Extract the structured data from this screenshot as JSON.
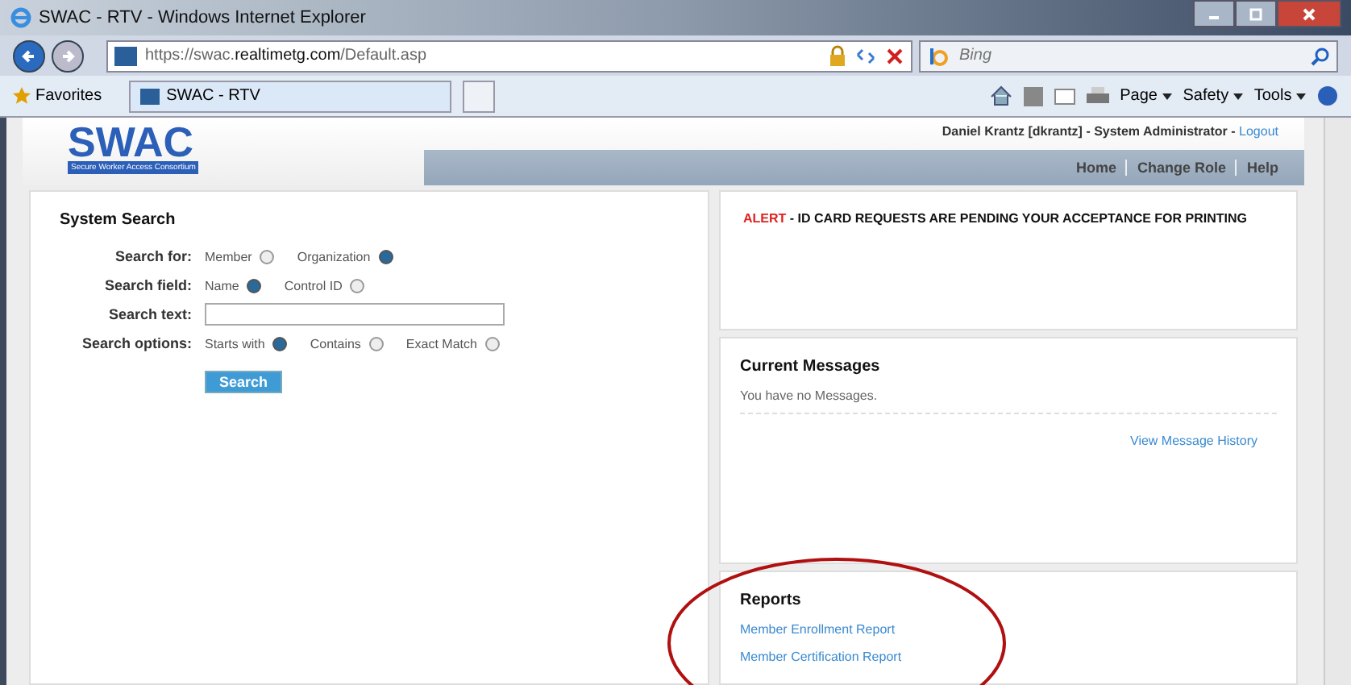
{
  "window": {
    "title": "SWAC - RTV - Windows Internet Explorer"
  },
  "address_bar": {
    "url": "https://swac.**realtimetg.com**/Default.asp",
    "search_placeholder": "Bing"
  },
  "favorites_bar": {
    "favorites": "Favorites",
    "tabs": [
      {
        "label": "SWAC - RTV",
        "selected": true
      }
    ],
    "menus": [
      "Page",
      "Safety",
      "Tools"
    ]
  },
  "header": {
    "logo": "SWAC",
    "logo_tagline": "Secure Worker Access Consortium",
    "user": "Daniel Krantz [dkrantz] - System Administrator -",
    "logout": "Logout",
    "nav": [
      "Home",
      "Change Role",
      "Help"
    ]
  },
  "system_search": {
    "title": "System Search",
    "rows": [
      {
        "kind": "radio",
        "label": "Search for:",
        "options": [
          {
            "label": "Member",
            "selected": false
          },
          {
            "label": "Organization",
            "selected": true
          }
        ]
      },
      {
        "kind": "radio",
        "label": "Search field:",
        "options": [
          {
            "label": "Name",
            "selected": true
          },
          {
            "label": "Control ID",
            "selected": false
          }
        ]
      },
      {
        "kind": "text",
        "label": "Search text:"
      },
      {
        "kind": "radio",
        "label": "Search options:",
        "options": [
          {
            "label": "Starts with",
            "selected": true
          },
          {
            "label": "Contains",
            "selected": false
          },
          {
            "label": "Exact Match",
            "selected": false
          }
        ]
      }
    ],
    "button": "Search"
  },
  "alert": {
    "tag": "ALERT",
    "message": "- ID CARD REQUESTS ARE PENDING YOUR ACCEPTANCE FOR PRINTING"
  },
  "messages": {
    "title": "Current Messages",
    "empty": "You have no Messages.",
    "history_link": "View Message History"
  },
  "reports": {
    "title": "Reports",
    "links": [
      "Member Enrollment Report",
      "Member Certification Report"
    ]
  }
}
